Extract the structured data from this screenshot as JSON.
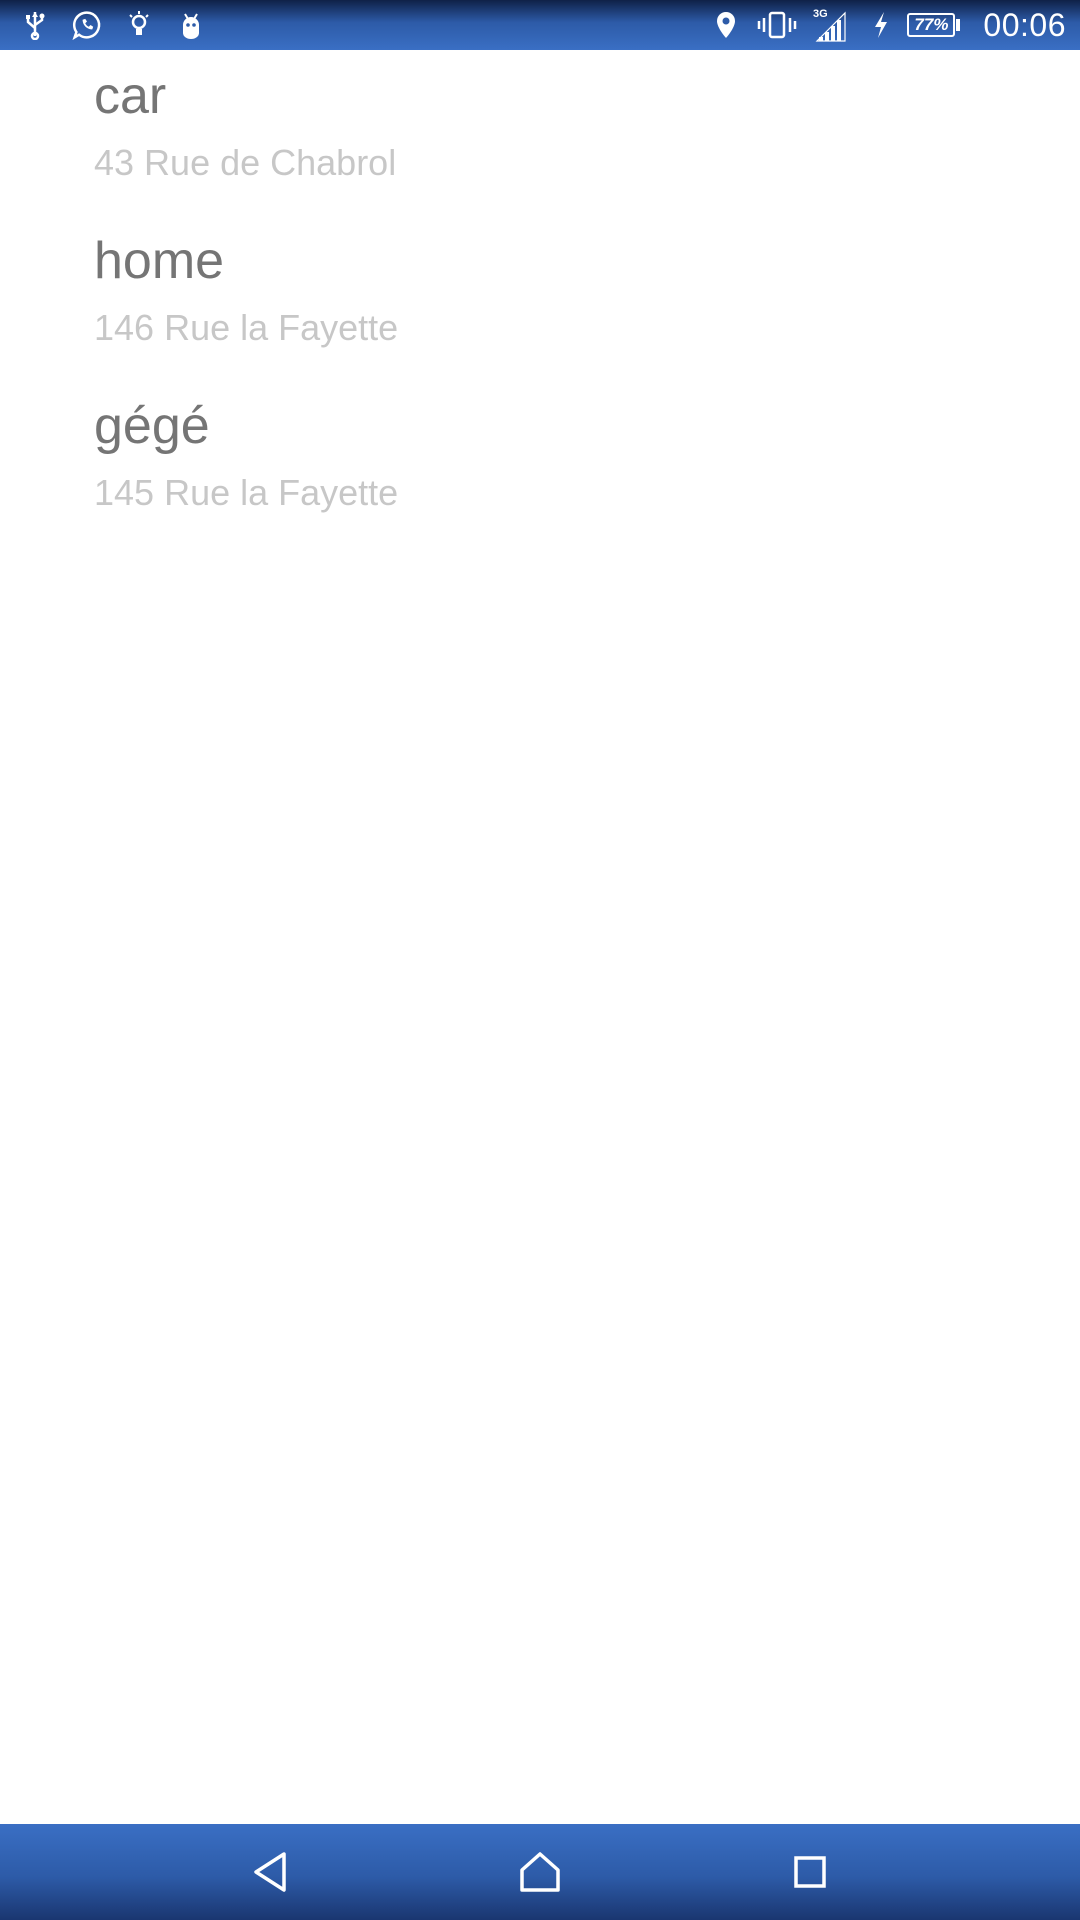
{
  "status_bar": {
    "left_icons": [
      "usb-icon",
      "whatsapp-icon",
      "lightbulb-icon",
      "android-debug-icon"
    ],
    "right_icons": [
      "location-icon",
      "vibrate-icon",
      "signal-icon",
      "charging-icon",
      "battery-icon"
    ],
    "network_type": "3G",
    "battery_percent": "77%",
    "time": "00:06",
    "color": "#2d5ba8"
  },
  "places": [
    {
      "name": "car",
      "address": "43 Rue de Chabrol"
    },
    {
      "name": "home",
      "address": "146 Rue la Fayette"
    },
    {
      "name": "gégé",
      "address": "145 Rue la Fayette"
    }
  ],
  "nav_bar": {
    "icons": [
      "back-icon",
      "home-icon",
      "recents-icon"
    ]
  },
  "colors": {
    "title_text": "#757575",
    "subtitle_text": "#c7c7c7",
    "bar_blue": "#3a6fc4"
  }
}
